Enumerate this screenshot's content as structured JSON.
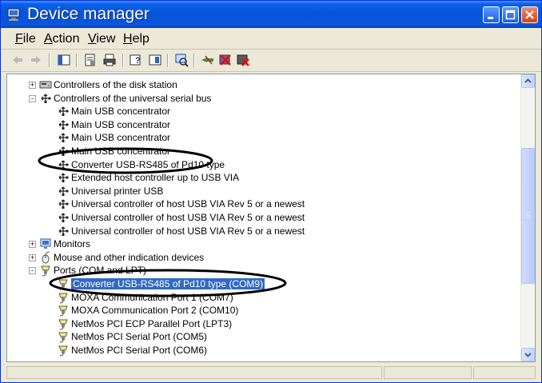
{
  "window": {
    "title": "Device manager"
  },
  "menu": {
    "items": [
      {
        "acc": "F",
        "rest": "ile"
      },
      {
        "acc": "A",
        "rest": "ction"
      },
      {
        "acc": "V",
        "rest": "iew"
      },
      {
        "acc": "H",
        "rest": "elp"
      }
    ]
  },
  "tree": {
    "rows": [
      {
        "label": "Controllers of the disk station",
        "expander": "+",
        "icon": "disk-controller-icon"
      },
      {
        "label": "Controllers of the universal serial bus",
        "expander": "-",
        "icon": "usb-icon"
      },
      {
        "label": "Main USB concentrator",
        "icon": "usb-icon"
      },
      {
        "label": "Main USB concentrator",
        "icon": "usb-icon"
      },
      {
        "label": "Main USB concentrator",
        "icon": "usb-icon"
      },
      {
        "label": "Main USB concentrator",
        "icon": "usb-icon"
      },
      {
        "label": "Converter USB-RS485 of Pd10 type",
        "icon": "usb-icon"
      },
      {
        "label": "Extended host controller up to USB VIA",
        "icon": "usb-icon"
      },
      {
        "label": "Universal printer USB",
        "icon": "usb-icon"
      },
      {
        "label": "Universal controller of host USB VIA Rev 5 or a newest",
        "icon": "usb-icon"
      },
      {
        "label": "Universal controller of host USB VIA Rev 5 or a newest",
        "icon": "usb-icon"
      },
      {
        "label": "Universal controller of host USB VIA Rev 5 or a newest",
        "icon": "usb-icon"
      },
      {
        "label": "Monitors",
        "expander": "+",
        "icon": "monitor-icon"
      },
      {
        "label": "Mouse and other indication devices",
        "expander": "+",
        "icon": "mouse-icon"
      },
      {
        "label": "Ports (COM and LPT)",
        "expander": "-",
        "icon": "port-icon"
      },
      {
        "label": "Converter USB-RS485 of Pd10 type (COM9)",
        "icon": "port-icon",
        "selected": true
      },
      {
        "label": "MOXA Communication Port 1 (COM7)",
        "icon": "port-icon"
      },
      {
        "label": "MOXA Communication Port 2 (COM10)",
        "icon": "port-icon"
      },
      {
        "label": "NetMos PCI ECP Parallel Port (LPT3)",
        "icon": "port-icon"
      },
      {
        "label": "NetMos PCI Serial Port (COM5)",
        "icon": "port-icon"
      },
      {
        "label": "NetMos PCI Serial Port (COM6)",
        "icon": "port-icon"
      }
    ]
  },
  "colors": {
    "selection": "#316ac5",
    "titlebar": "#0653d6",
    "annotation": "#000000"
  }
}
